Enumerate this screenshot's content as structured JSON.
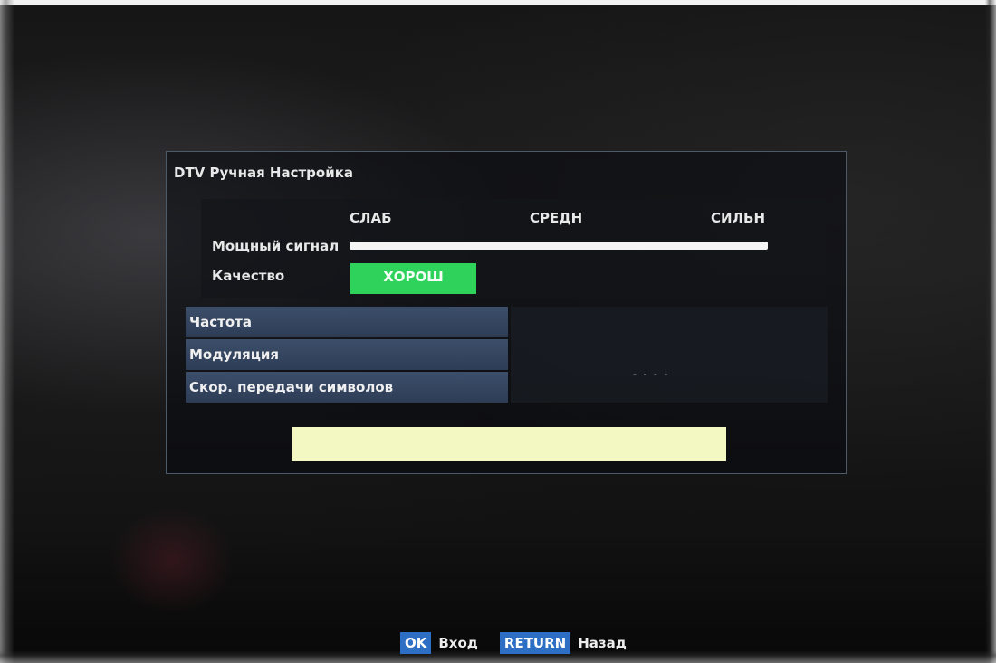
{
  "dialog": {
    "title": "DTV Ручная Настройка"
  },
  "signal": {
    "scale_labels": {
      "weak": "СЛАБ",
      "medium": "СРЕДН",
      "strong": "СИЛЬН"
    },
    "strength_label": "Мощный сигнал",
    "strength_level_fraction": 1.0,
    "quality_label": "Качество",
    "quality_value": "ХОРОШ",
    "quality_color": "#2fd35c"
  },
  "info": {
    "rows": [
      {
        "label": "Частота"
      },
      {
        "label": "Модуляция"
      },
      {
        "label": "Скор. передачи символов"
      }
    ],
    "value_placeholder": "- - - -"
  },
  "progress": {
    "fill_color": "#f3f8c2"
  },
  "footer": {
    "ok_key": "OK",
    "ok_label": "Вход",
    "return_key": "RETURN",
    "return_label": "Назад",
    "key_color": "#2d6fc4"
  }
}
